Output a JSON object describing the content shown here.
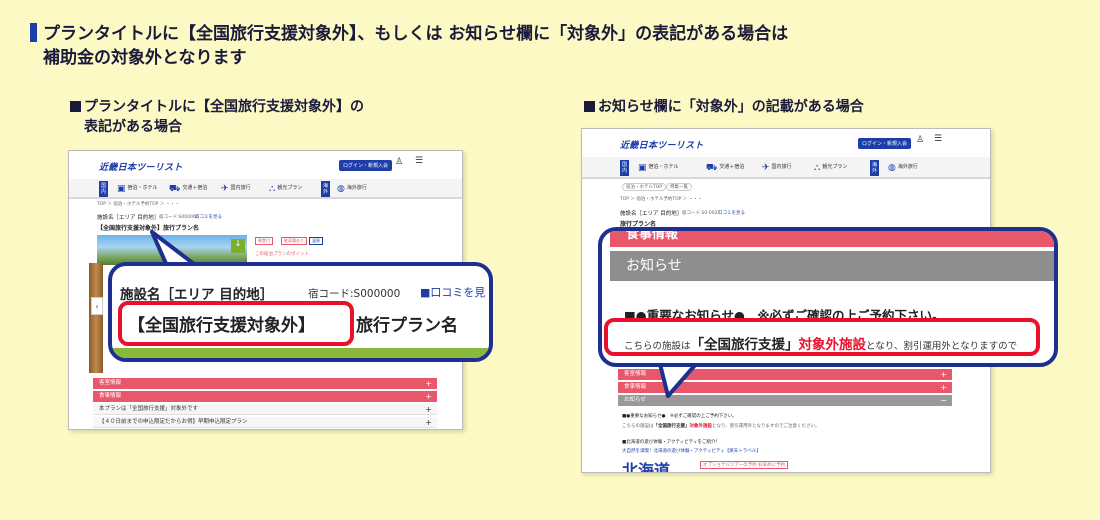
{
  "headline": {
    "line1": "プランタイトルに【全国旅行支援対象外】、もしくは お知らせ欄に「対象外」の表記がある場合は",
    "line2": "補助金の対象外となります"
  },
  "left_panel": {
    "heading_line1": "プランタイトルに【全国旅行支援対象外】の",
    "heading_line2": "表記がある場合",
    "site": {
      "logo": "近畿日本ツーリスト",
      "login_button": "ログイン・新規入会",
      "nav_tag": "国内",
      "nav_items": [
        "宿泊・ホテル",
        "交通＋宿泊",
        "国内旅行",
        "観光プラン",
        "海外旅行"
      ],
      "overseas_tag": "海外",
      "breadcrumb": "TOP ＞ 宿泊・ホテル予約TOP ＞ ・・・",
      "facility_line": "施設名［エリア 目的地］",
      "inn_code_small": "宿コード:S000000",
      "review_small": "口コミを見る",
      "plan_title_small": "【全国旅行支援対象外】旅行プラン名",
      "tags": [
        "朝食付",
        "駐車場あり",
        "温泉"
      ],
      "point_label": "この宿泊プランのポイント",
      "accordions": [
        {
          "label": "客室情報"
        },
        {
          "label": "食事情報"
        },
        {
          "label": "本プランは「全国旅行支援」対象外です"
        },
        {
          "label": "【４０日前までの申込限定だからお得】早期申込限定プラン"
        }
      ]
    },
    "zoom": {
      "facility": "施設名［エリア 目的地］",
      "inn_code": "宿コード:S000000",
      "review": "口コミを見",
      "highlight": "【全国旅行支援対象外】",
      "plan_name": "旅行プラン名"
    }
  },
  "right_panel": {
    "heading": "お知らせ欄に「対象外」の記載がある場合",
    "site": {
      "logo": "近畿日本ツーリスト",
      "login_button": "ログイン・新規入会",
      "nav_tag": "国内",
      "nav_items": [
        "宿泊・ホテル",
        "交通＋宿泊",
        "国内旅行",
        "観光プラン",
        "海外旅行"
      ],
      "overseas_tag": "海外",
      "subnav": [
        "宿泊・ホテルTOP",
        "特集一覧"
      ],
      "breadcrumb": "TOP ＞ 宿泊・ホテル予約TOP ＞ ・・・",
      "facility_line": "施設名［エリア 目的地］",
      "inn_code_small": "宿コード:S0-0027",
      "review_small": "口コミを見る",
      "plan_title_small": "旅行プラン名",
      "accordions": [
        {
          "label": "客室情報"
        },
        {
          "label": "食事情報"
        },
        {
          "label": "お知らせ"
        }
      ],
      "notice_small": "■●重要なお知らせ●　※必ずご確認の上ご予約下さい。",
      "notice_body_prefix": "こちらの施設は",
      "notice_body_bold": "「全国旅行支援」",
      "notice_body_red": "対象外施設",
      "notice_body_suffix": "となり、割引運用外となりますのでご注意ください。",
      "hokkaido_title": "■北海道の遊び体験・アクティビティをご紹介！",
      "hokkaido_link": "大自然を満喫！北海道の遊び体験・アクティビティ【楽天トラベル】",
      "hokkaido_logo": "北海道",
      "hokkaido_badge": "オプショナルツアーの予約 お早めに予約",
      "menu_label": "MENU",
      "mypage_label": "会員登録 / ログイン"
    },
    "zoom": {
      "top_partial": "食事情報",
      "notice_header": "お知らせ",
      "important": "■●重要なお知らせ●　※必ずご確認の上ご予約下さい。",
      "body_prefix": "こちらの施設は",
      "body_bold": "「全国旅行支援」",
      "body_red": "対象外施設",
      "body_suffix": "となり、割引運用外となりますので"
    }
  },
  "colors": {
    "background": "#fdf9c4",
    "navy": "#1d2f8f",
    "brand_blue": "#1d3da8",
    "accent_red": "#e8102b",
    "accordion_red": "#e8576a",
    "green": "#7ab02d"
  }
}
